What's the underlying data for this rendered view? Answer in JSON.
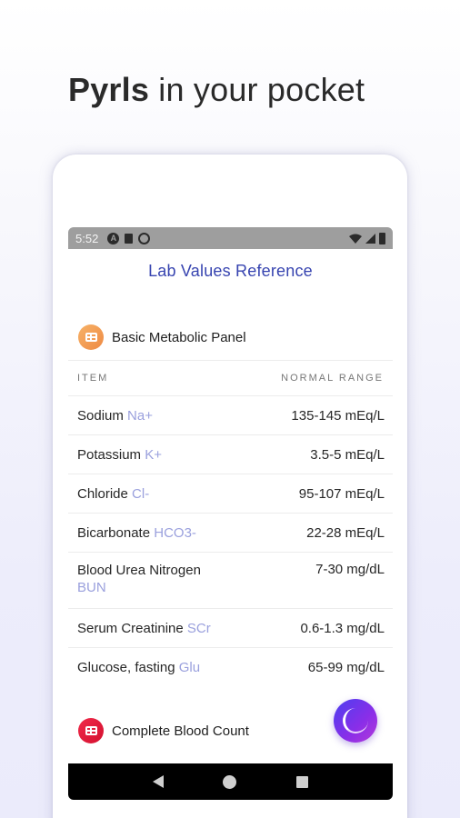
{
  "headline": {
    "brand": "Pyrls",
    "rest": " in your pocket"
  },
  "status_bar": {
    "time": "5:52",
    "icons": [
      "a-notification-icon",
      "sim-card-icon",
      "sync-icon",
      "wifi-icon",
      "signal-icon",
      "battery-icon"
    ]
  },
  "app": {
    "title": "Lab Values Reference"
  },
  "sections": [
    {
      "label": "Basic Metabolic Panel",
      "icon": "grid-icon",
      "color": "#f2a25a"
    },
    {
      "label": "Complete Blood Count",
      "icon": "grid-icon",
      "color": "#e0193d"
    }
  ],
  "table": {
    "headers": {
      "item": "ITEM",
      "range": "NORMAL RANGE"
    },
    "rows": [
      {
        "name": "Sodium",
        "abbr": "Na+",
        "range": "135-145 mEq/L"
      },
      {
        "name": "Potassium",
        "abbr": "K+",
        "range": "3.5-5 mEq/L"
      },
      {
        "name": "Chloride",
        "abbr": "Cl-",
        "range": "95-107 mEq/L"
      },
      {
        "name": "Bicarbonate",
        "abbr": "HCO3-",
        "range": "22-28 mEq/L"
      },
      {
        "name": "Blood Urea Nitrogen",
        "abbr": "BUN",
        "range": "7-30 mg/dL"
      },
      {
        "name": "Serum Creatinine",
        "abbr": "SCr",
        "range": "0.6-1.3 mg/dL"
      },
      {
        "name": "Glucose, fasting",
        "abbr": "Glu",
        "range": "65-99 mg/dL"
      }
    ]
  },
  "colors": {
    "accent": "#3744b0",
    "abbr": "#9aa0dd",
    "fab_start": "#4c3ff0",
    "fab_end": "#b43ad9"
  }
}
